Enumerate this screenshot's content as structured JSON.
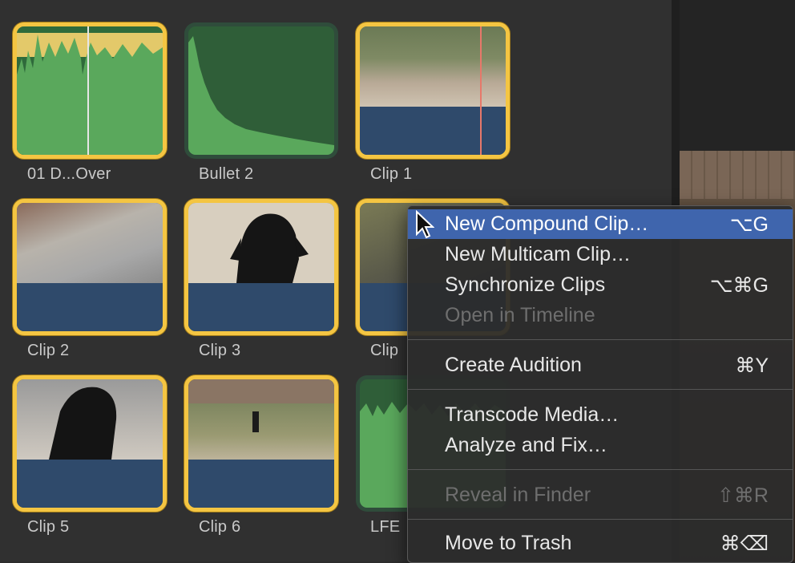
{
  "clips": [
    {
      "name": "01 D...Over",
      "selected": true,
      "kind": "audio-only"
    },
    {
      "name": "Bullet 2",
      "selected": false,
      "kind": "audio-only"
    },
    {
      "name": "Clip 1",
      "selected": true,
      "kind": "video"
    },
    {
      "name": "Clip 2",
      "selected": true,
      "kind": "video"
    },
    {
      "name": "Clip 3",
      "selected": true,
      "kind": "video"
    },
    {
      "name": "Clip",
      "selected": true,
      "kind": "video"
    },
    {
      "name": "Clip 5",
      "selected": true,
      "kind": "video"
    },
    {
      "name": "Clip 6",
      "selected": true,
      "kind": "video"
    },
    {
      "name": "LFE",
      "selected": false,
      "kind": "audio-only"
    }
  ],
  "context_menu": {
    "items": [
      {
        "label": "New Compound Clip…",
        "shortcut": "⌥G",
        "highlighted": true,
        "disabled": false
      },
      {
        "label": "New Multicam Clip…",
        "shortcut": "",
        "highlighted": false,
        "disabled": false
      },
      {
        "label": "Synchronize Clips",
        "shortcut": "⌥⌘G",
        "highlighted": false,
        "disabled": false
      },
      {
        "label": "Open in Timeline",
        "shortcut": "",
        "highlighted": false,
        "disabled": true
      },
      {
        "label": "Create Audition",
        "shortcut": "⌘Y",
        "highlighted": false,
        "disabled": false
      },
      {
        "label": "Transcode Media…",
        "shortcut": "",
        "highlighted": false,
        "disabled": false
      },
      {
        "label": "Analyze and Fix…",
        "shortcut": "",
        "highlighted": false,
        "disabled": false
      },
      {
        "label": "Reveal in Finder",
        "shortcut": "⇧⌘R",
        "highlighted": false,
        "disabled": true
      },
      {
        "label": "Move to Trash",
        "shortcut": "⌘⌫",
        "highlighted": false,
        "disabled": false
      }
    ]
  },
  "colors": {
    "selection_border": "#f4c542",
    "audio_waveform": "#5aa85c",
    "menu_highlight": "#3f65ad"
  }
}
